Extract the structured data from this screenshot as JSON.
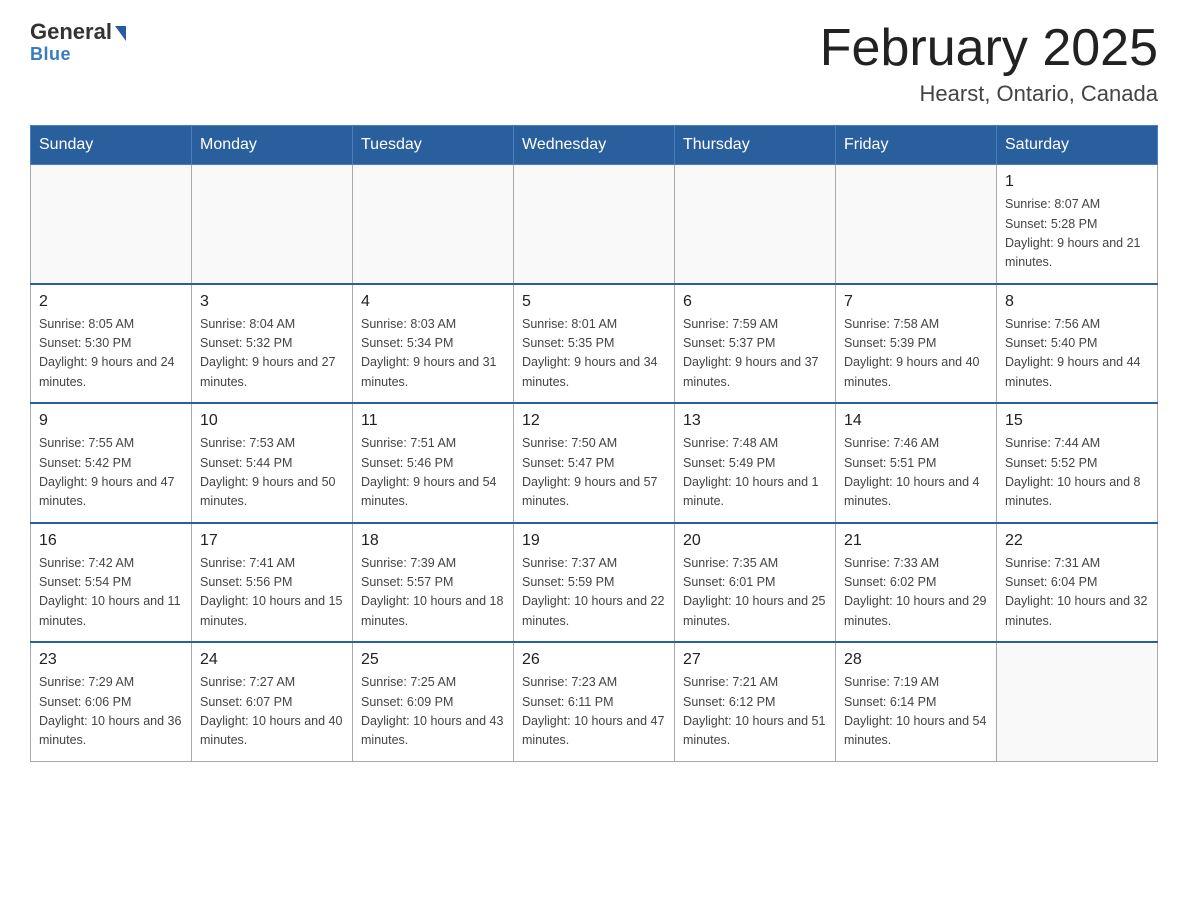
{
  "header": {
    "logo_line1": "General",
    "logo_line2": "Blue",
    "month": "February 2025",
    "location": "Hearst, Ontario, Canada"
  },
  "days_of_week": [
    "Sunday",
    "Monday",
    "Tuesday",
    "Wednesday",
    "Thursday",
    "Friday",
    "Saturday"
  ],
  "weeks": [
    [
      {
        "day": "",
        "info": ""
      },
      {
        "day": "",
        "info": ""
      },
      {
        "day": "",
        "info": ""
      },
      {
        "day": "",
        "info": ""
      },
      {
        "day": "",
        "info": ""
      },
      {
        "day": "",
        "info": ""
      },
      {
        "day": "1",
        "info": "Sunrise: 8:07 AM\nSunset: 5:28 PM\nDaylight: 9 hours and 21 minutes."
      }
    ],
    [
      {
        "day": "2",
        "info": "Sunrise: 8:05 AM\nSunset: 5:30 PM\nDaylight: 9 hours and 24 minutes."
      },
      {
        "day": "3",
        "info": "Sunrise: 8:04 AM\nSunset: 5:32 PM\nDaylight: 9 hours and 27 minutes."
      },
      {
        "day": "4",
        "info": "Sunrise: 8:03 AM\nSunset: 5:34 PM\nDaylight: 9 hours and 31 minutes."
      },
      {
        "day": "5",
        "info": "Sunrise: 8:01 AM\nSunset: 5:35 PM\nDaylight: 9 hours and 34 minutes."
      },
      {
        "day": "6",
        "info": "Sunrise: 7:59 AM\nSunset: 5:37 PM\nDaylight: 9 hours and 37 minutes."
      },
      {
        "day": "7",
        "info": "Sunrise: 7:58 AM\nSunset: 5:39 PM\nDaylight: 9 hours and 40 minutes."
      },
      {
        "day": "8",
        "info": "Sunrise: 7:56 AM\nSunset: 5:40 PM\nDaylight: 9 hours and 44 minutes."
      }
    ],
    [
      {
        "day": "9",
        "info": "Sunrise: 7:55 AM\nSunset: 5:42 PM\nDaylight: 9 hours and 47 minutes."
      },
      {
        "day": "10",
        "info": "Sunrise: 7:53 AM\nSunset: 5:44 PM\nDaylight: 9 hours and 50 minutes."
      },
      {
        "day": "11",
        "info": "Sunrise: 7:51 AM\nSunset: 5:46 PM\nDaylight: 9 hours and 54 minutes."
      },
      {
        "day": "12",
        "info": "Sunrise: 7:50 AM\nSunset: 5:47 PM\nDaylight: 9 hours and 57 minutes."
      },
      {
        "day": "13",
        "info": "Sunrise: 7:48 AM\nSunset: 5:49 PM\nDaylight: 10 hours and 1 minute."
      },
      {
        "day": "14",
        "info": "Sunrise: 7:46 AM\nSunset: 5:51 PM\nDaylight: 10 hours and 4 minutes."
      },
      {
        "day": "15",
        "info": "Sunrise: 7:44 AM\nSunset: 5:52 PM\nDaylight: 10 hours and 8 minutes."
      }
    ],
    [
      {
        "day": "16",
        "info": "Sunrise: 7:42 AM\nSunset: 5:54 PM\nDaylight: 10 hours and 11 minutes."
      },
      {
        "day": "17",
        "info": "Sunrise: 7:41 AM\nSunset: 5:56 PM\nDaylight: 10 hours and 15 minutes."
      },
      {
        "day": "18",
        "info": "Sunrise: 7:39 AM\nSunset: 5:57 PM\nDaylight: 10 hours and 18 minutes."
      },
      {
        "day": "19",
        "info": "Sunrise: 7:37 AM\nSunset: 5:59 PM\nDaylight: 10 hours and 22 minutes."
      },
      {
        "day": "20",
        "info": "Sunrise: 7:35 AM\nSunset: 6:01 PM\nDaylight: 10 hours and 25 minutes."
      },
      {
        "day": "21",
        "info": "Sunrise: 7:33 AM\nSunset: 6:02 PM\nDaylight: 10 hours and 29 minutes."
      },
      {
        "day": "22",
        "info": "Sunrise: 7:31 AM\nSunset: 6:04 PM\nDaylight: 10 hours and 32 minutes."
      }
    ],
    [
      {
        "day": "23",
        "info": "Sunrise: 7:29 AM\nSunset: 6:06 PM\nDaylight: 10 hours and 36 minutes."
      },
      {
        "day": "24",
        "info": "Sunrise: 7:27 AM\nSunset: 6:07 PM\nDaylight: 10 hours and 40 minutes."
      },
      {
        "day": "25",
        "info": "Sunrise: 7:25 AM\nSunset: 6:09 PM\nDaylight: 10 hours and 43 minutes."
      },
      {
        "day": "26",
        "info": "Sunrise: 7:23 AM\nSunset: 6:11 PM\nDaylight: 10 hours and 47 minutes."
      },
      {
        "day": "27",
        "info": "Sunrise: 7:21 AM\nSunset: 6:12 PM\nDaylight: 10 hours and 51 minutes."
      },
      {
        "day": "28",
        "info": "Sunrise: 7:19 AM\nSunset: 6:14 PM\nDaylight: 10 hours and 54 minutes."
      },
      {
        "day": "",
        "info": ""
      }
    ]
  ]
}
